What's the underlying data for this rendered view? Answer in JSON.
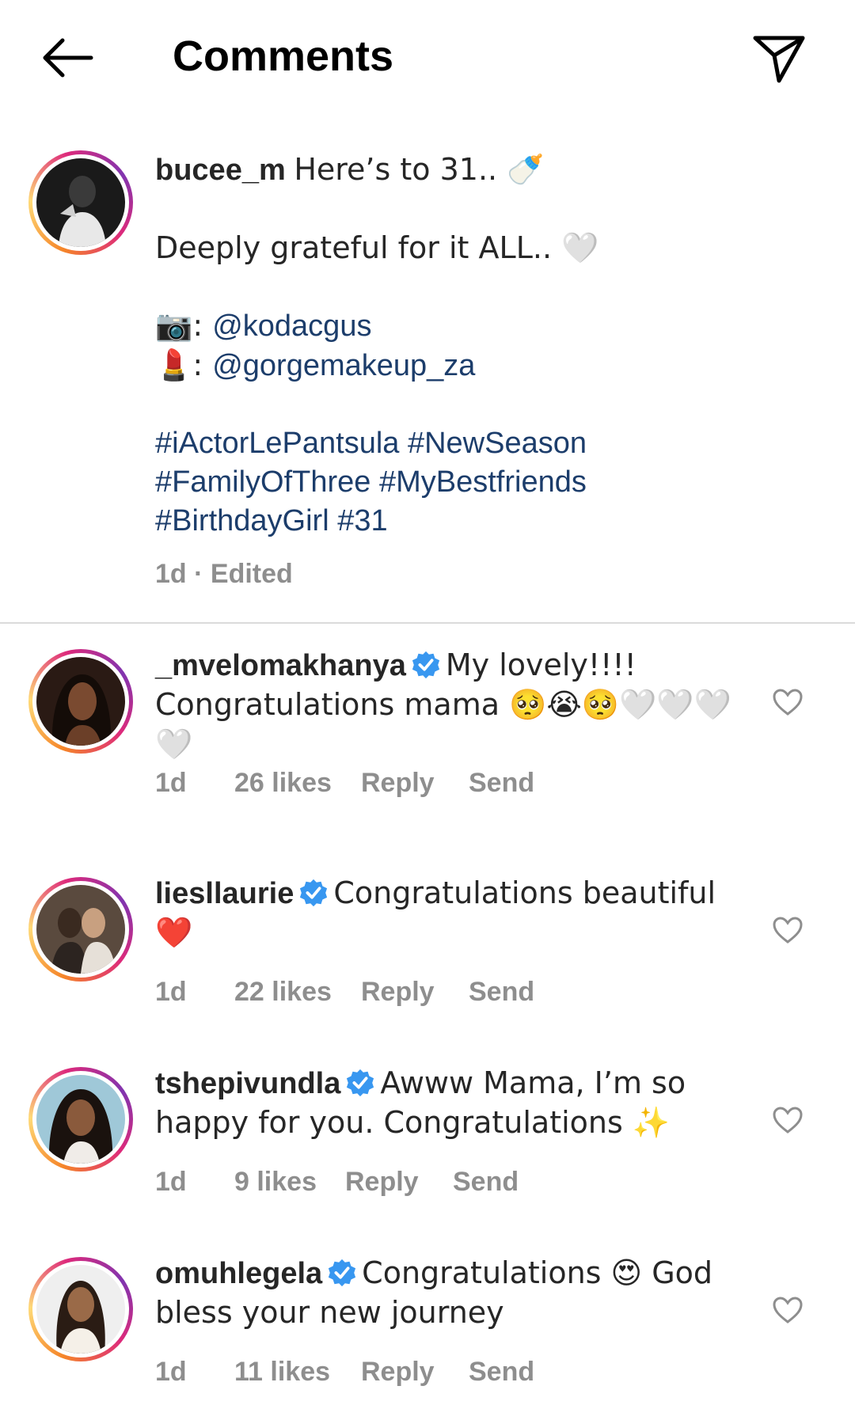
{
  "header": {
    "title": "Comments",
    "back_icon": "arrow-left-icon",
    "send_icon": "paper-plane-icon"
  },
  "caption": {
    "username": "bucee_m",
    "line1": "Here’s to 31.. 🍼",
    "line2": "Deeply grateful for it ALL.. 🤍",
    "camera_prefix": "📷: ",
    "camera_mention": "@kodacgus",
    "lipstick_prefix": "💄: ",
    "lipstick_mention": "@gorgemakeup_za",
    "hashtags_1": "#iActorLePantsula #NewSeason",
    "hashtags_2": "#FamilyOfThree #MyBestfriends",
    "hashtags_3": "#BirthdayGirl #31",
    "meta": "1d · Edited"
  },
  "colors": {
    "link": "#1c3d6b",
    "verified": "#3897f0",
    "meta": "#8e8e8e"
  },
  "comments": [
    {
      "username": "_mvelomakhanya",
      "text": "My lovely!!!! Congratulations mama 🥺😭🥺🤍🤍🤍🤍",
      "time": "1d",
      "likes": "26 likes",
      "reply": "Reply",
      "send": "Send"
    },
    {
      "username": "liesllaurie",
      "text": "Congratulations beautiful ❤️",
      "time": "1d",
      "likes": "22 likes",
      "reply": "Reply",
      "send": "Send"
    },
    {
      "username": "tshepivundla",
      "text": "Awww Mama, I’m so happy for you. Congratulations ✨",
      "time": "1d",
      "likes": "9 likes",
      "reply": "Reply",
      "send": "Send"
    },
    {
      "username": "omuhlegela",
      "text": "Congratulations 😍 God bless your new journey",
      "time": "1d",
      "likes": "11 likes",
      "reply": "Reply",
      "send": "Send"
    }
  ]
}
